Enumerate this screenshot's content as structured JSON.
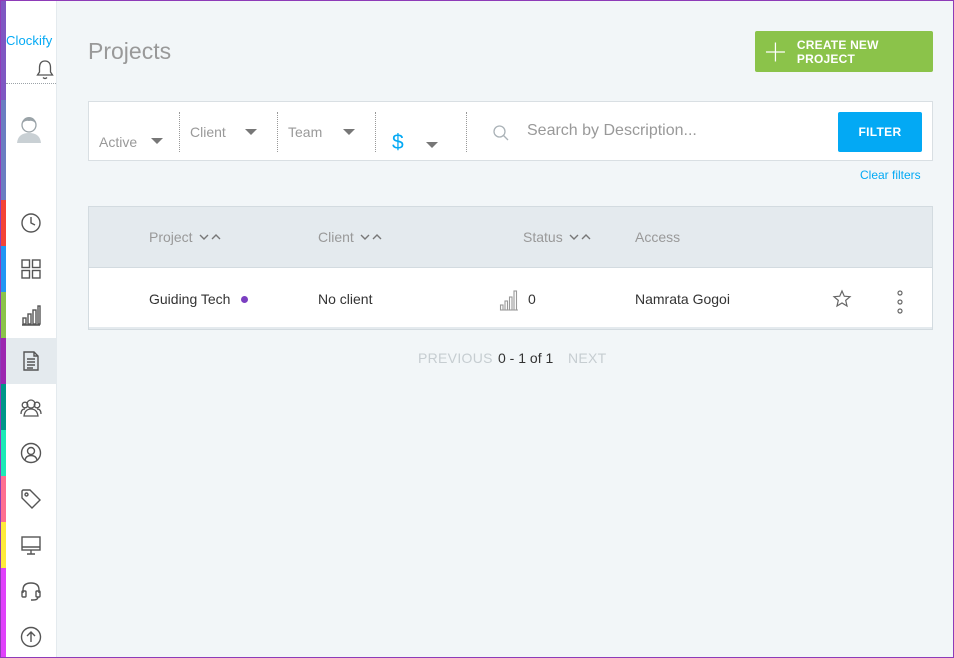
{
  "app": {
    "logo_text": "Clockify"
  },
  "colors": {
    "accent_blue": "#03a9f4",
    "create_green": "#8bc34a",
    "project_dot": "#7b3fc1",
    "sidebar_strips": [
      "#7e57c2",
      "#6a7ec1",
      "#f44336",
      "#2196f3",
      "#8bc34a",
      "#9c27b0",
      "#009688",
      "#1de9b6",
      "#ff6f91",
      "#ffeb3b",
      "#e040fb"
    ]
  },
  "sidebar": {
    "icons": [
      "bell-icon",
      "avatar-icon",
      "clock-icon",
      "dashboard-icon",
      "reports-icon",
      "projects-icon",
      "teams-icon",
      "user-icon",
      "tag-icon",
      "monitor-icon",
      "headset-icon",
      "upload-icon"
    ],
    "active": "projects-icon"
  },
  "page": {
    "title": "Projects",
    "create_button_label": "CREATE NEW PROJECT"
  },
  "filters": {
    "status_value": "Active",
    "client_label": "Client",
    "team_label": "Team",
    "billable_symbol": "$",
    "search_placeholder": "Search by Description...",
    "filter_button_label": "FILTER",
    "clear_filters_label": "Clear filters"
  },
  "table": {
    "columns": {
      "project": "Project",
      "client": "Client",
      "status": "Status",
      "access": "Access"
    },
    "rows": [
      {
        "project": "Guiding Tech",
        "client": "No client",
        "status": "0",
        "access": "Namrata Gogoi"
      }
    ]
  },
  "pagination": {
    "previous_label": "PREVIOUS",
    "range_label": "0 - 1 of 1",
    "next_label": "NEXT"
  }
}
